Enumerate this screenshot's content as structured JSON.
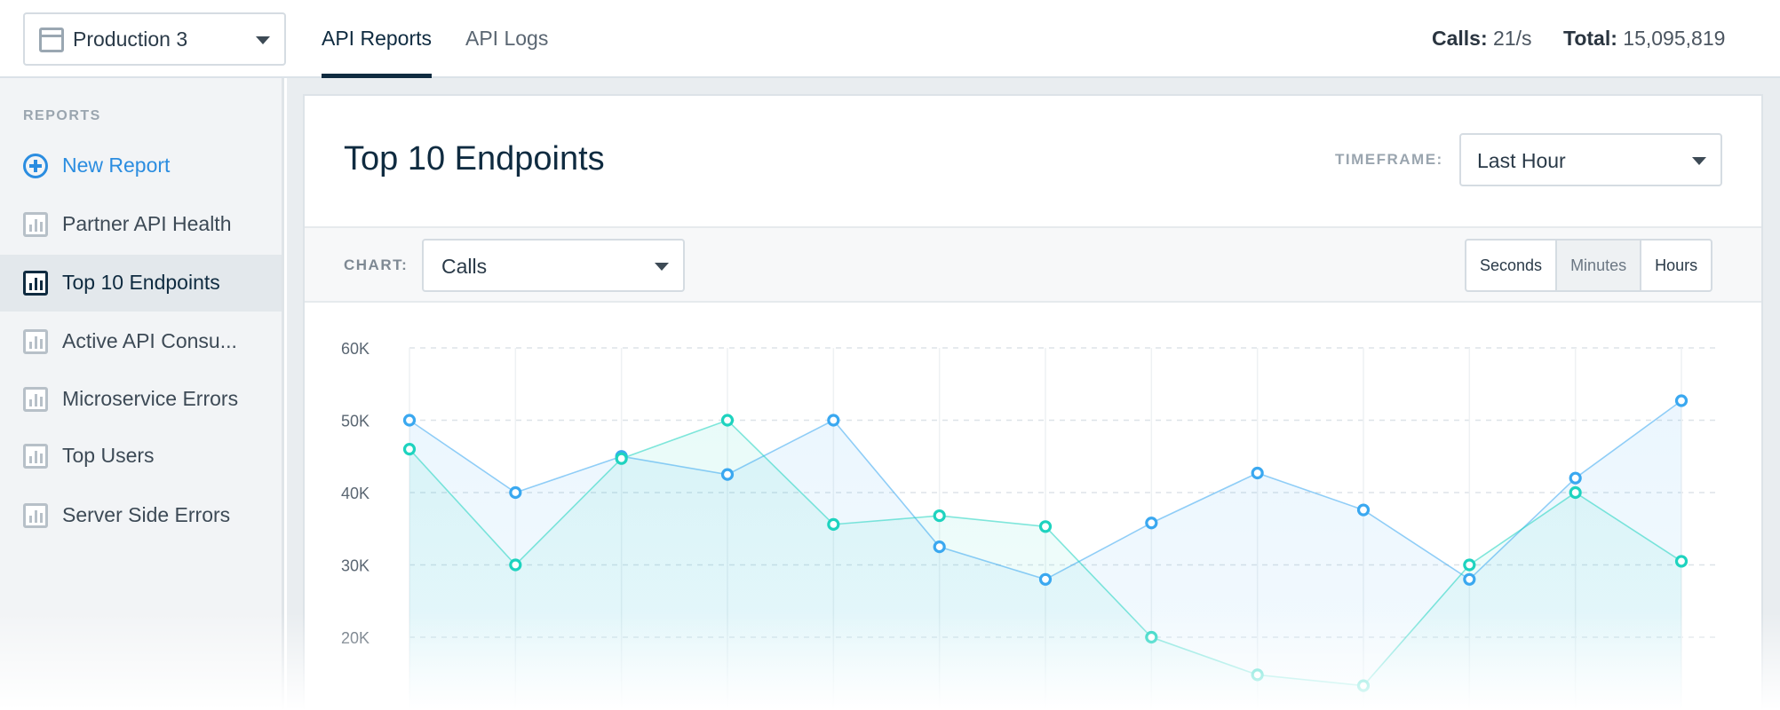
{
  "header": {
    "environment": "Production 3",
    "tabs": [
      {
        "label": "API Reports",
        "active": true
      },
      {
        "label": "API Logs",
        "active": false
      }
    ],
    "calls_label": "Calls:",
    "calls_value": "21/s",
    "total_label": "Total:",
    "total_value": "15,095,819"
  },
  "sidebar": {
    "heading": "REPORTS",
    "new_report": "New Report",
    "items": [
      {
        "label": "Partner API Health"
      },
      {
        "label": "Top 10 Endpoints",
        "active": true
      },
      {
        "label": "Active API Consu..."
      },
      {
        "label": "Microservice Errors"
      },
      {
        "label": "Top Users"
      },
      {
        "label": "Server Side Errors"
      }
    ]
  },
  "panel": {
    "title": "Top 10 Endpoints",
    "timeframe_label": "TIMEFRAME:",
    "timeframe_value": "Last Hour",
    "chart_label": "CHART:",
    "chart_metric": "Calls",
    "granularity": [
      "Seconds",
      "Minutes",
      "Hours"
    ],
    "granularity_active": "Minutes"
  },
  "colors": {
    "accent": "#2b8de0",
    "navy": "#0f2b40",
    "series_blue": "#3aa8f0",
    "series_teal": "#1ed3bf"
  },
  "chart_data": {
    "type": "area",
    "title": "",
    "xlabel": "",
    "ylabel": "",
    "y_ticks": [
      "60K",
      "50K",
      "40K",
      "30K",
      "20K"
    ],
    "ylim": [
      0,
      60000
    ],
    "grid": true,
    "series": [
      {
        "values": [
          50000,
          40000,
          45000,
          42500,
          50000,
          32500,
          28000,
          35800,
          42700,
          37600,
          28000,
          42000,
          52700
        ]
      },
      {
        "values": [
          46000,
          30000,
          44700,
          50000,
          35600,
          36800,
          35300,
          20000,
          14800,
          13300,
          30000,
          40000,
          30500
        ]
      }
    ]
  }
}
